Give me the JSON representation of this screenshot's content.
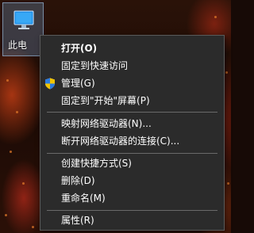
{
  "desktop": {
    "this_pc_label": "此电"
  },
  "context_menu": {
    "items": [
      {
        "label": "打开(O)",
        "bold": true
      },
      {
        "label": "固定到快速访问"
      },
      {
        "label": "管理(G)",
        "icon": "uac-shield-icon"
      },
      {
        "label": "固定到\"开始\"屏幕(P)"
      },
      {
        "label": "映射网络驱动器(N)..."
      },
      {
        "label": "断开网络驱动器的连接(C)..."
      },
      {
        "label": "创建快捷方式(S)"
      },
      {
        "label": "删除(D)"
      },
      {
        "label": "重命名(M)"
      },
      {
        "label": "属性(R)"
      }
    ]
  },
  "colors": {
    "menu_background": "#2b2b2b",
    "menu_text": "#ffffff",
    "separator": "#6a6a6a"
  }
}
